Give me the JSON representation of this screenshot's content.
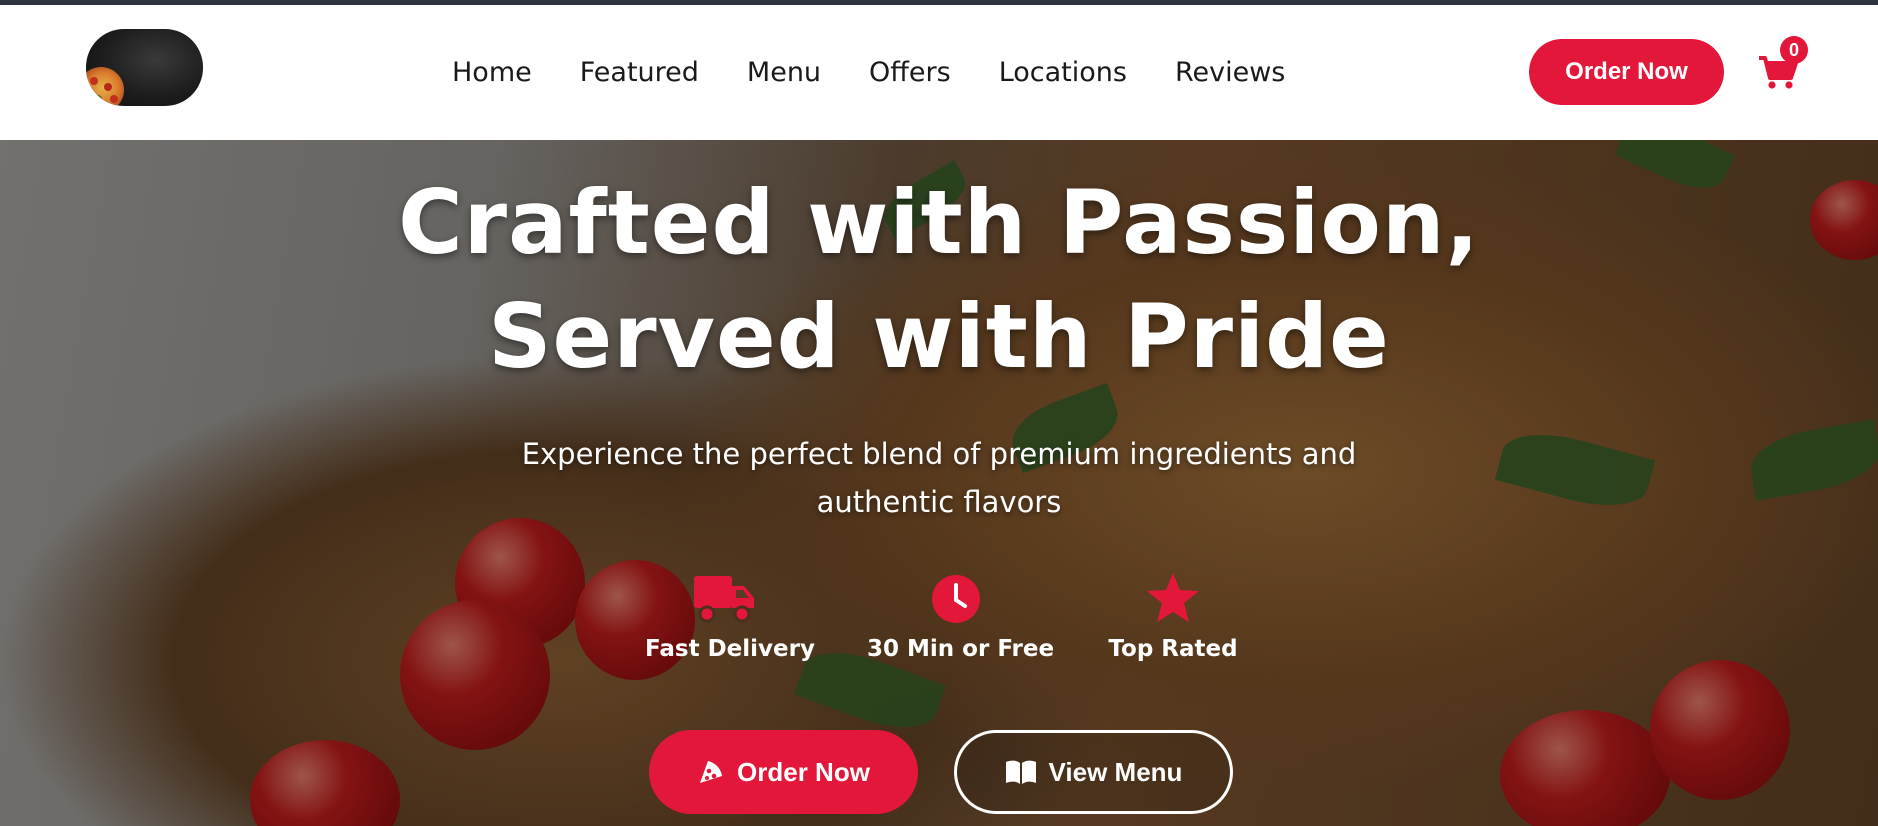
{
  "nav": {
    "links": [
      "Home",
      "Featured",
      "Menu",
      "Offers",
      "Locations",
      "Reviews"
    ],
    "order_button": "Order Now",
    "cart_count": "0"
  },
  "hero": {
    "title_line1": "Crafted with Passion,",
    "title_line2": "Served with Pride",
    "subtitle_line1": "Experience the perfect blend of premium ingredients and",
    "subtitle_line2": "authentic flavors",
    "features": [
      {
        "label": "Fast Delivery",
        "icon": "truck-icon"
      },
      {
        "label": "30 Min or Free",
        "icon": "clock-icon"
      },
      {
        "label": "Top Rated",
        "icon": "star-icon"
      }
    ],
    "order_button": "Order Now",
    "menu_button": "View Menu"
  },
  "colors": {
    "accent": "#e3173a",
    "nav_text": "#1a1a1a",
    "hero_text": "#ffffff"
  }
}
